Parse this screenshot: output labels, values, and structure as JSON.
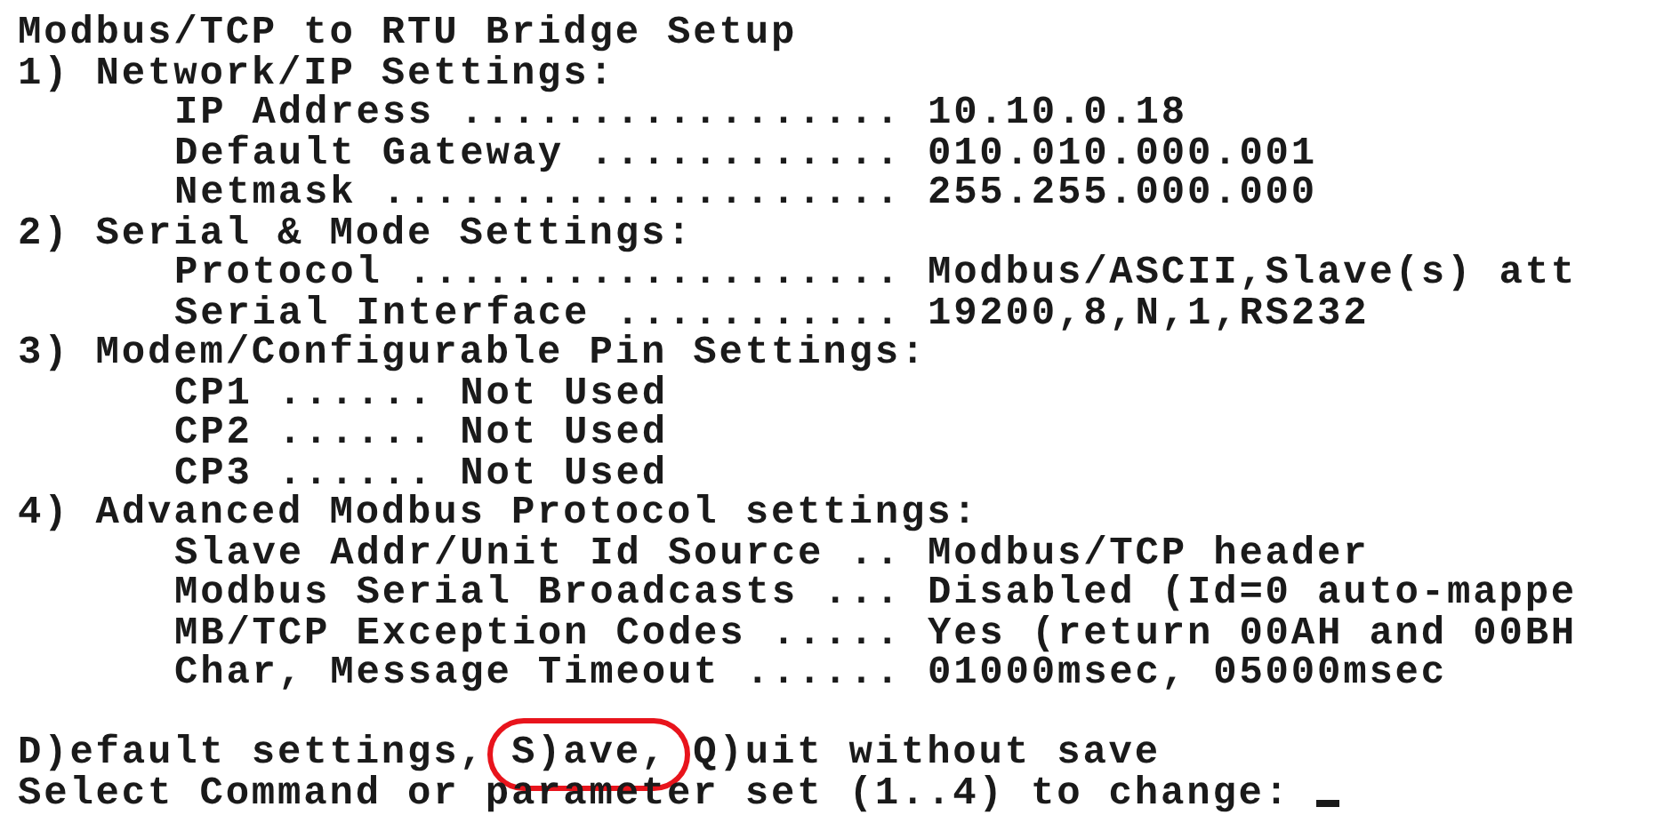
{
  "title": "Modbus/TCP to RTU Bridge Setup",
  "sections": [
    {
      "heading": "1) Network/IP Settings:",
      "items": [
        {
          "label": "IP Address .................",
          "value": "10.10.0.18"
        },
        {
          "label": "Default Gateway ............",
          "value": "010.010.000.001"
        },
        {
          "label": "Netmask ....................",
          "value": "255.255.000.000"
        }
      ]
    },
    {
      "heading": "2) Serial & Mode Settings:",
      "items": [
        {
          "label": "Protocol ...................",
          "value": "Modbus/ASCII,Slave(s) att"
        },
        {
          "label": "Serial Interface ...........",
          "value": "19200,8,N,1,RS232"
        }
      ]
    },
    {
      "heading": "3) Modem/Configurable Pin Settings:",
      "items": [
        {
          "label": "CP1 ......",
          "value": "Not Used"
        },
        {
          "label": "CP2 ......",
          "value": "Not Used"
        },
        {
          "label": "CP3 ......",
          "value": "Not Used"
        }
      ]
    },
    {
      "heading": "4) Advanced Modbus Protocol settings:",
      "items": [
        {
          "label": "Slave Addr/Unit Id Source ..",
          "value": "Modbus/TCP header"
        },
        {
          "label": "Modbus Serial Broadcasts ...",
          "value": "Disabled (Id=0 auto-mappe"
        },
        {
          "label": "MB/TCP Exception Codes .....",
          "value": "Yes (return 00AH and 00BH"
        },
        {
          "label": "Char, Message Timeout ......",
          "value": "01000msec, 05000msec"
        }
      ]
    }
  ],
  "commands": [
    {
      "text": "D)efault settings,",
      "highlighted": false
    },
    {
      "text": "S)ave,",
      "highlighted": true
    },
    {
      "text": "Q)uit without save",
      "highlighted": false
    }
  ],
  "prompt": "Select Command or parameter set (1..4) to change:"
}
